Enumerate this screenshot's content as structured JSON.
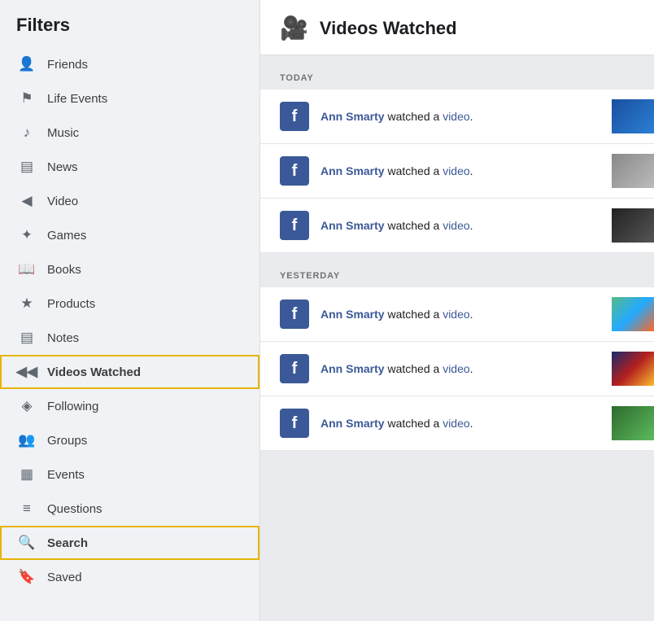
{
  "sidebar": {
    "title": "Filters",
    "items": [
      {
        "id": "friends",
        "label": "Friends",
        "icon": "👤",
        "active": false
      },
      {
        "id": "life-events",
        "label": "Life Events",
        "icon": "🔖",
        "active": false
      },
      {
        "id": "music",
        "label": "Music",
        "icon": "🎵",
        "active": false
      },
      {
        "id": "news",
        "label": "News",
        "icon": "📰",
        "active": false
      },
      {
        "id": "video",
        "label": "Video",
        "icon": "📹",
        "active": false
      },
      {
        "id": "games",
        "label": "Games",
        "icon": "🎮",
        "active": false
      },
      {
        "id": "books",
        "label": "Books",
        "icon": "📚",
        "active": false
      },
      {
        "id": "products",
        "label": "Products",
        "icon": "🏷",
        "active": false
      },
      {
        "id": "notes",
        "label": "Notes",
        "icon": "📋",
        "active": false
      },
      {
        "id": "videos-watched",
        "label": "Videos Watched",
        "icon": "📷",
        "active": true
      },
      {
        "id": "following",
        "label": "Following",
        "icon": "📡",
        "active": false
      },
      {
        "id": "groups",
        "label": "Groups",
        "icon": "👥",
        "active": false
      },
      {
        "id": "events",
        "label": "Events",
        "icon": "📅",
        "active": false
      },
      {
        "id": "questions",
        "label": "Questions",
        "icon": "📊",
        "active": false
      },
      {
        "id": "search",
        "label": "Search",
        "icon": "🔍",
        "active": true
      },
      {
        "id": "saved",
        "label": "Saved",
        "icon": "🔖",
        "active": false
      }
    ]
  },
  "main": {
    "header": {
      "icon": "📹",
      "title": "Videos Watched"
    },
    "sections": [
      {
        "label": "TODAY",
        "items": [
          {
            "user": "Ann Smarty",
            "text_before": "watched a ",
            "link_text": "video",
            "thumb_class": "thumb-blue"
          },
          {
            "user": "Ann Smarty",
            "text_before": "watched a ",
            "link_text": "video",
            "thumb_class": "thumb-gray"
          },
          {
            "user": "Ann Smarty",
            "text_before": "watched a ",
            "link_text": "video",
            "thumb_class": "thumb-dark"
          }
        ]
      },
      {
        "label": "YESTERDAY",
        "items": [
          {
            "user": "Ann Smarty",
            "text_before": "watched a ",
            "link_text": "video",
            "thumb_class": "thumb-multi"
          },
          {
            "user": "Ann Smarty",
            "text_before": "watched a ",
            "link_text": "video",
            "thumb_class": "thumb-police"
          },
          {
            "user": "Ann Smarty",
            "text_before": "watched a ",
            "link_text": "video",
            "thumb_class": "thumb-green"
          }
        ]
      }
    ]
  }
}
